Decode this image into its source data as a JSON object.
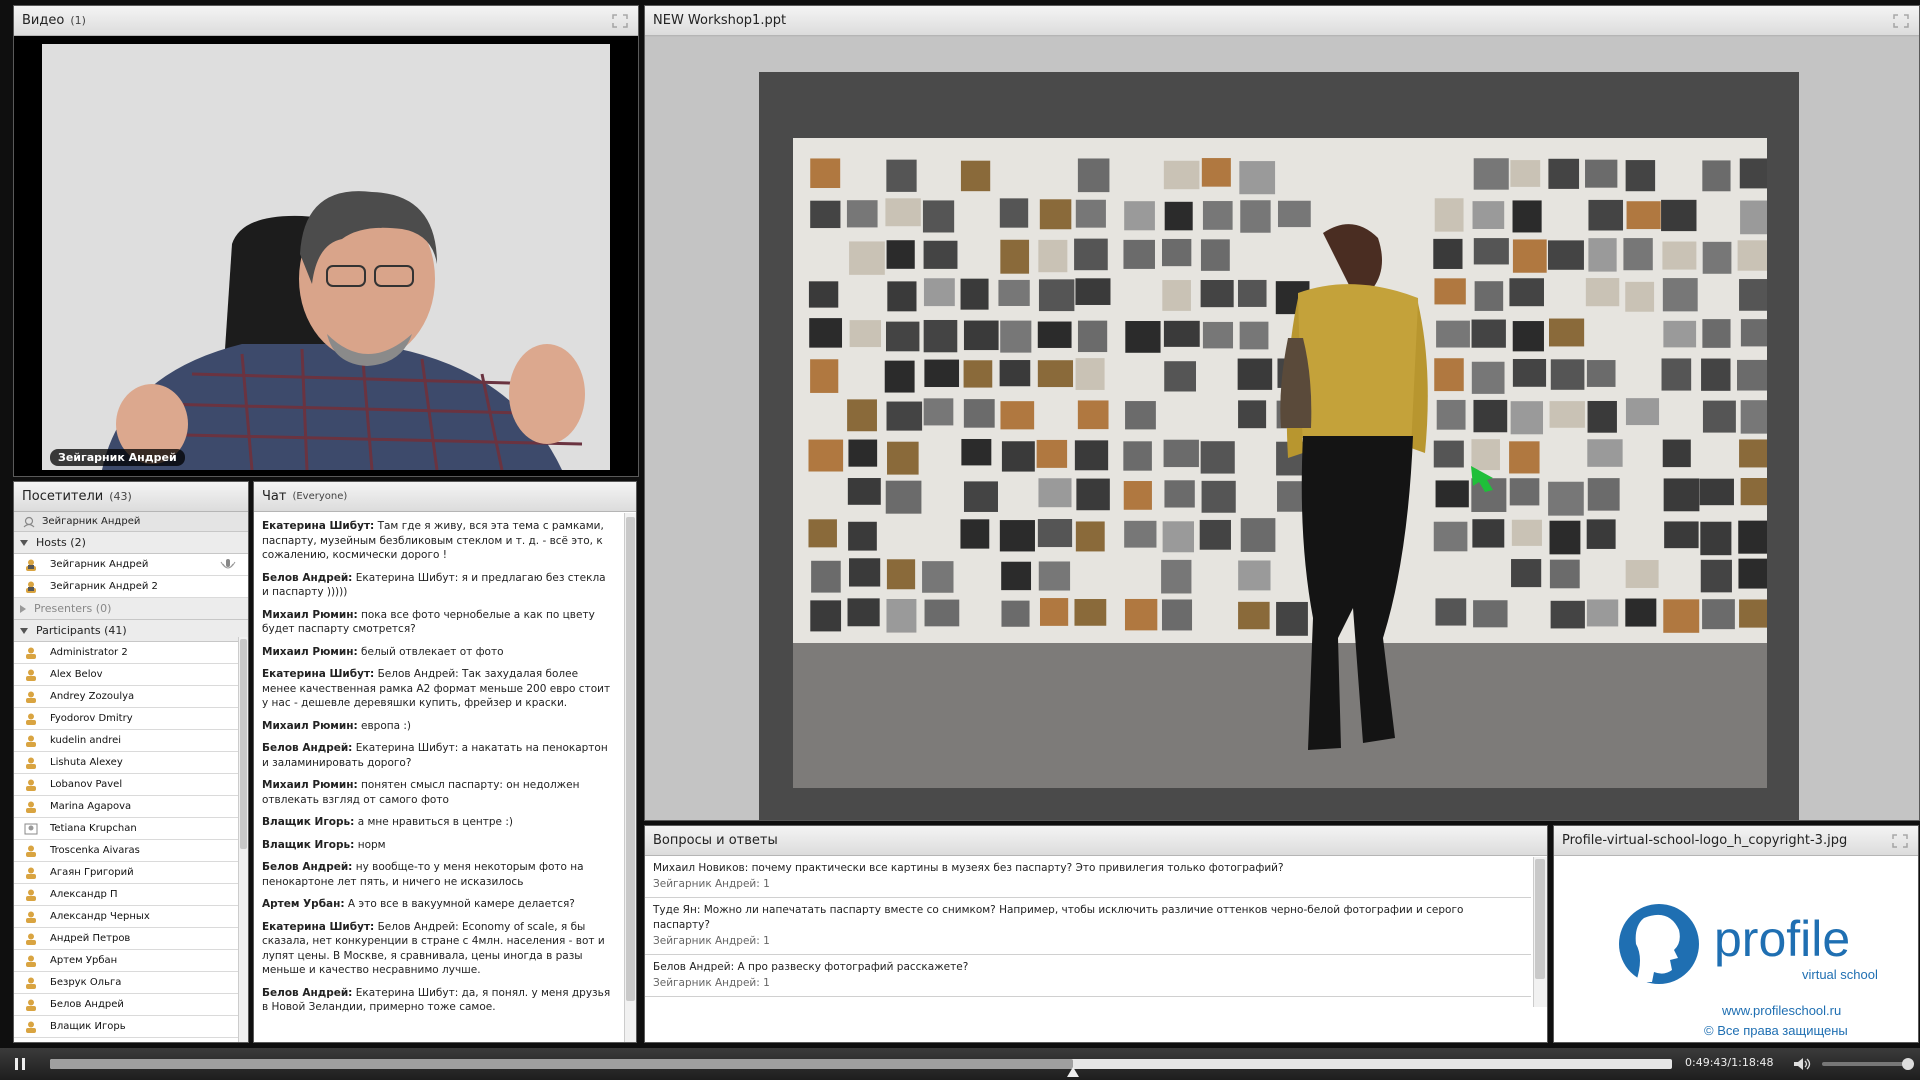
{
  "video_pod": {
    "title": "Видео",
    "count": "(1)",
    "speaker_name": "Зейгарник Андрей"
  },
  "attendees": {
    "title": "Посетители",
    "count": "(43)",
    "me": "Зейгарник Андрей",
    "hosts_label": "Hosts (2)",
    "hosts": [
      "Зейгарник Андрей",
      "Зейгарник Андрей 2"
    ],
    "presenters_label": "Presenters (0)",
    "participants_label": "Participants (41)",
    "participants": [
      "Administrator 2",
      "Alex Belov",
      "Andrey Zozoulya",
      "Fyodorov Dmitry",
      "kudelin andrei",
      "Lishuta Alexey",
      "Lobanov Pavel",
      "Marina Agapova",
      "Tetiana Krupchan",
      "Troscenka Aivaras",
      "Агаян Григорий",
      "Александр П",
      "Александр Черных",
      "Андрей Петров",
      "Артем Урбан",
      "Безрук Ольга",
      "Белов Андрей",
      "Влащик Игорь"
    ]
  },
  "chat": {
    "title": "Чат",
    "scope": "(Everyone)",
    "messages": [
      {
        "author": "Екатерина Шибут:",
        "text": " Там где я живу, вся эта тема с рамками, паспарту, музейным безбликовым стеклом и т. д. - всё это, к сожалению, космически дорого !"
      },
      {
        "author": "Белов Андрей:",
        "text": " Екатерина Шибут: я и предлагаю без стекла и паспарту )))))"
      },
      {
        "author": "Михаил Рюмин:",
        "text": " пока все фото чернобелые а как по цвету будет паспарту смотрется?"
      },
      {
        "author": "Михаил Рюмин:",
        "text": " белый отвлекает от фото"
      },
      {
        "author": "Екатерина Шибут:",
        "text": " Белов Андрей: Так захудалая более менее качественная рамка А2 формат меньше 200 евро стоит у нас - дешевле деревяшки купить, фрейзер и краски."
      },
      {
        "author": "Михаил Рюмин:",
        "text": " европа :)"
      },
      {
        "author": "Белов Андрей:",
        "text": " Екатерина Шибут:  а накатать на пенокартон и заламинировать дорого?"
      },
      {
        "author": "Михаил Рюмин:",
        "text": " понятен смысл паспарту: он недолжен отвлекать взгляд от самого фото"
      },
      {
        "author": "Влащик Игорь:",
        "text": " а мне нравиться в центре :)"
      },
      {
        "author": "Влащик Игорь:",
        "text": " норм"
      },
      {
        "author": "Белов Андрей:",
        "text": " ну вообще-то у меня некоторым фото на пенокартоне лет пять, и ничего не исказилось"
      },
      {
        "author": "Артем Урбан:",
        "text": " А это все в вакуумной камере делается?"
      },
      {
        "author": "Екатерина Шибут:",
        "text": " Белов Андрей: Economy of scale, я бы сказала, нет конкуренции в стране с 4млн. населения - вот и лупят цены. В Москве, я сравнивала, цены иногда в разы меньше и качество несравнимо лучше."
      },
      {
        "author": "Белов Андрей:",
        "text": " Екатерина Шибут:  да, я понял. у меня друзья в Новой Зеландии, примерно тоже самое."
      }
    ]
  },
  "presentation": {
    "title": "NEW Workshop1.ppt"
  },
  "qa": {
    "title": "Вопросы и ответы",
    "items": [
      {
        "question": "Михаил Новиков:  почему практически все картины в музеях без паспарту? Это привилегия только фотографий?",
        "answer": "Зейгарник Андрей: 1"
      },
      {
        "question": "Туде Ян: Можно ли напечатать паспарту вместе со снимком? Например, чтобы исключить различие оттенков черно-белой фотографии и серого паспарту?",
        "answer": "Зейгарник Андрей: 1"
      },
      {
        "question": "Белов Андрей: А про развеску фотографий расскажете?",
        "answer": "Зейгарник Андрей: 1"
      }
    ]
  },
  "logo_pod": {
    "title": "Profile-virtual-school-logo_h_copyright-3.jpg",
    "brand": "profile",
    "tagline": "virtual school",
    "url": "www.profileschool.ru",
    "copyright": "© Все права защищены",
    "brand_color": "#1f6fb2"
  },
  "playbar": {
    "timecode": "0:49:43/1:18:48",
    "progress": 0.631
  },
  "icons": [
    "fullscreen-icon",
    "user-icon",
    "host-icon",
    "microphone-icon",
    "pause-icon",
    "volume-icon"
  ]
}
